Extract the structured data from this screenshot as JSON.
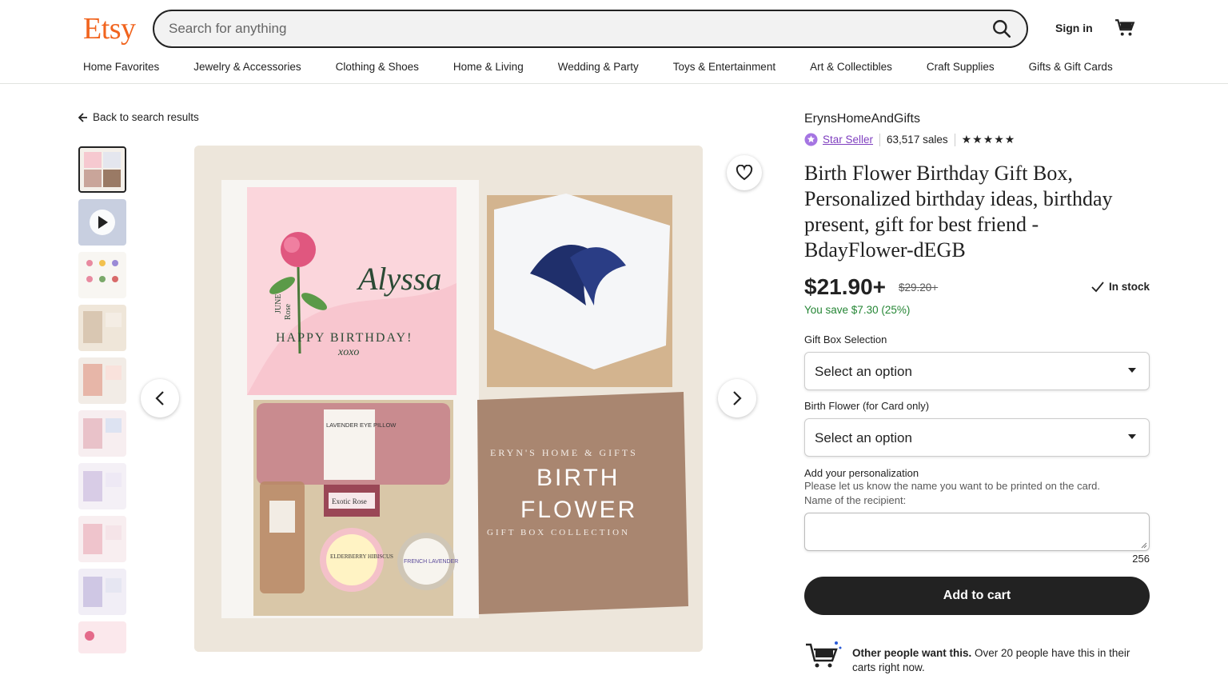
{
  "header": {
    "logo": "Etsy",
    "search_placeholder": "Search for anything",
    "signin": "Sign in"
  },
  "nav": [
    "Home Favorites",
    "Jewelry & Accessories",
    "Clothing & Shoes",
    "Home & Living",
    "Wedding & Party",
    "Toys & Entertainment",
    "Art & Collectibles",
    "Craft Supplies",
    "Gifts & Gift Cards"
  ],
  "back_label": "Back to search results",
  "image": {
    "card_name": "Alyssa",
    "card_month": "JUNE",
    "card_flower": "Rose",
    "card_greeting": "HAPPY BIRTHDAY!",
    "card_xoxo": "xoxo",
    "pillow_label": "LAVENDER EYE PILLOW",
    "soap_label": "Exotic Rose",
    "tin1_label": "ELDERBERRY HIBISCUS",
    "tin2_label": "FRENCH LAVENDER",
    "brand_line": "ERYN'S HOME & GIFTS",
    "big1": "BIRTH",
    "big2": "FLOWER",
    "collection": "GIFT BOX COLLECTION"
  },
  "product": {
    "shop": "ErynsHomeAndGifts",
    "star_seller": "Star Seller",
    "sales": "63,517 sales",
    "rating_stars": "★★★★★",
    "title": "Birth Flower Birthday Gift Box, Personalized birthday ideas, birthday present, gift for best friend - BdayFlower-dEGB",
    "price": "$21.90+",
    "old_price": "$29.20+",
    "in_stock": "In stock",
    "save_text": "You save $7.30 (25%)",
    "option1_label": "Gift Box Selection",
    "option1_value": "Select an option",
    "option2_label": "Birth Flower (for Card only)",
    "option2_value": "Select an option",
    "pers_label": "Add your personalization",
    "pers_help1": "Please let us know the name you want to be printed on the card.",
    "pers_help2": "Name of the recipient:",
    "char_count": "256",
    "add_to_cart": "Add to cart",
    "other_bold": "Other people want this.",
    "other_rest": " Over 20 people have this in their carts right now."
  }
}
